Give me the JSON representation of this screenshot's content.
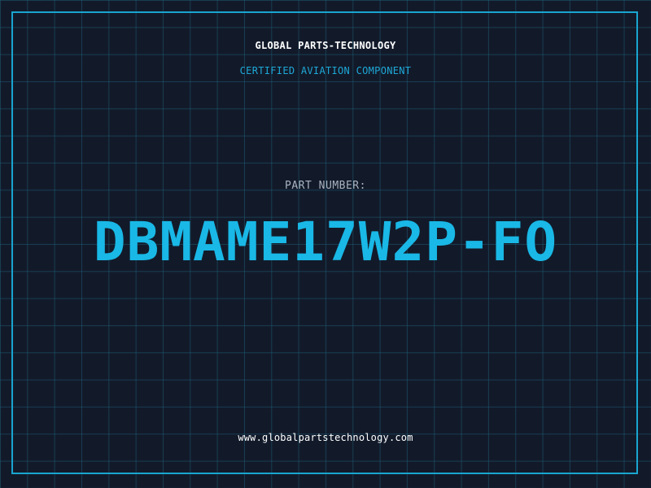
{
  "header": {
    "company": "GLOBAL PARTS-TECHNOLOGY",
    "subtitle": "CERTIFIED AVIATION COMPONENT"
  },
  "part": {
    "label": "PART NUMBER:",
    "number": "DBMAME17W2P-FO"
  },
  "footer": {
    "url": "www.globalpartstechnology.com"
  },
  "colors": {
    "background": "#121a2a",
    "grid": "#1f6880",
    "frame": "#19a5cf",
    "accent": "#19b8e6",
    "title": "#ffffff",
    "label": "#a8b3c0"
  }
}
